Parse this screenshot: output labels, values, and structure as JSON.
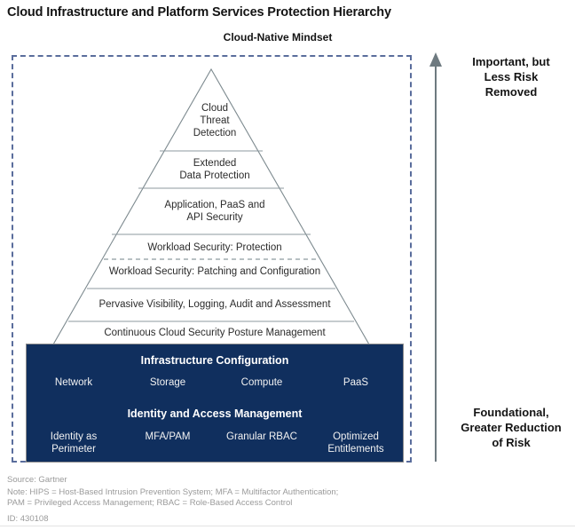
{
  "header": {
    "title": "Cloud Infrastructure and Platform Services Protection Hierarchy",
    "subtitle": "Cloud-Native Mindset"
  },
  "chart_data": {
    "type": "pyramid",
    "title": "Cloud Infrastructure and Platform Services Protection Hierarchy",
    "subtitle": "Cloud-Native Mindset",
    "orientation": "apex-top",
    "boundary_label": "Cloud-Native Mindset",
    "layers": [
      {
        "index": 1,
        "label": "Cloud\nThreat\nDetection",
        "divider_below": "solid"
      },
      {
        "index": 2,
        "label": "Extended\nData Protection",
        "divider_below": "solid"
      },
      {
        "index": 3,
        "label": "Application, PaaS and\nAPI Security",
        "divider_below": "solid"
      },
      {
        "index": 4,
        "label": "Workload Security: Protection",
        "divider_below": "dashed"
      },
      {
        "index": 5,
        "label": "Workload Security: Patching and Configuration",
        "divider_below": "solid"
      },
      {
        "index": 6,
        "label": "Pervasive Visibility, Logging, Audit and Assessment",
        "divider_below": "solid"
      },
      {
        "index": 7,
        "label": "Continuous Cloud Security Posture Management",
        "divider_below": "solid"
      }
    ],
    "base": {
      "color": "#102f5e",
      "sections": [
        {
          "heading": "Infrastructure Configuration",
          "items": [
            "Network",
            "Storage",
            "Compute",
            "PaaS"
          ]
        },
        {
          "heading": "Identity and Access Management",
          "items": [
            "Identity as\nPerimeter",
            "MFA/PAM",
            "Granular RBAC",
            "Optimized\nEntitlements"
          ]
        }
      ]
    },
    "axis": {
      "direction": "up",
      "top_label": "Important, but\nLess Risk\nRemoved",
      "bottom_label": "Foundational,\nGreater Reduction\nof Risk"
    }
  },
  "pyramid": {
    "layer_1": "Cloud\nThreat\nDetection",
    "layer_2": "Extended\nData Protection",
    "layer_3": "Application, PaaS and\nAPI Security",
    "layer_4": "Workload Security: Protection",
    "layer_5": "Workload Security: Patching and Configuration",
    "layer_6": "Pervasive Visibility, Logging, Audit and Assessment",
    "layer_7": "Continuous Cloud Security Posture Management"
  },
  "base": {
    "infrastructure_heading": "Infrastructure Configuration",
    "infrastructure_items": [
      "Network",
      "Storage",
      "Compute",
      "PaaS"
    ],
    "iam_heading": "Identity and Access Management",
    "iam_items": [
      "Identity as\nPerimeter",
      "MFA/PAM",
      "Granular RBAC",
      "Optimized\nEntitlements"
    ]
  },
  "risk_axis": {
    "top_label": "Important, but\nLess Risk\nRemoved",
    "bottom_label": "Foundational,\nGreater Reduction\nof Risk"
  },
  "footnotes": {
    "source": "Source: Gartner",
    "note_line1": "Note: HIPS = Host-Based Intrusion Prevention System; MFA = Multifactor Authentication;",
    "note_line2": "PAM = Privileged Access Management; RBAC = Role-Based Access Control",
    "id": "ID: 430108"
  },
  "colors": {
    "base_navy": "#102f5e",
    "boundary_dash": "#5a6d9c",
    "pyramid_stroke": "#7d8a8f",
    "axis_gray": "#6e7a80"
  }
}
